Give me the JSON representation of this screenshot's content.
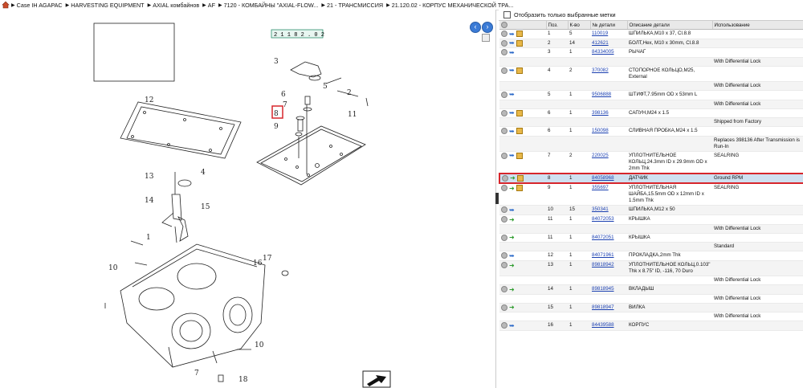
{
  "breadcrumb": [
    "Case IH AGAPAC",
    "HARVESTING EQUIPMENT",
    "AXIAL комбайнов",
    "AF",
    "7120 - КОМБАЙНЫ \"AXIAL-FLOW...",
    "21 - ТРАНСМИССИЯ",
    "21.120.02 - КОРПУС МЕХАНИЧЕСКОЙ ТРА..."
  ],
  "filter_label": "Отобразить только выбранные метки",
  "columns": [
    "",
    "Поз.",
    "К-во",
    "№ детали",
    "Описание детали",
    "Использование"
  ],
  "diagram": {
    "code": "2 1 1 8 2 . 0 2",
    "callouts": [
      "3",
      "5",
      "12",
      "6",
      "7",
      "8",
      "9",
      "2",
      "11",
      "13",
      "4",
      "14",
      "15",
      "1",
      "10",
      "16",
      "17",
      "10",
      "7",
      "18"
    ]
  },
  "rows": [
    {
      "icons": "cb",
      "pos": "1",
      "qty": "5",
      "pn": "110019",
      "desc": "ШПИЛЬКА,M10 x 37, Cl.8.8",
      "use": ""
    },
    {
      "icons": "cb",
      "pos": "2",
      "qty": "14",
      "pn": "412621",
      "desc": "БОЛТ,Hex, M10 x 30mm, Cl.8.8",
      "use": ""
    },
    {
      "icons": "c",
      "pos": "3",
      "qty": "1",
      "pn": "84334005",
      "desc": "РЫЧАГ",
      "use": ""
    },
    {
      "icons": "",
      "pos": "",
      "qty": "",
      "pn": "",
      "desc": "",
      "use": "With Differential Lock"
    },
    {
      "icons": "cb",
      "pos": "4",
      "qty": "2",
      "pn": "370082",
      "desc": "СТОПОРНОЕ КОЛЬЦО,M25, External",
      "use": ""
    },
    {
      "icons": "",
      "pos": "",
      "qty": "",
      "pn": "",
      "desc": "",
      "use": "With Differential Lock"
    },
    {
      "icons": "c",
      "pos": "5",
      "qty": "1",
      "pn": "9506888",
      "desc": "ШТИФТ,7.95mm OD x 53mm L",
      "use": ""
    },
    {
      "icons": "",
      "pos": "",
      "qty": "",
      "pn": "",
      "desc": "",
      "use": "With Differential Lock"
    },
    {
      "icons": "cb",
      "pos": "6",
      "qty": "1",
      "pn": "398136",
      "desc": "САПУН,M24 x 1.5",
      "use": ""
    },
    {
      "icons": "",
      "pos": "",
      "qty": "",
      "pn": "",
      "desc": "",
      "use": "Shipped from Factory"
    },
    {
      "icons": "cb",
      "pos": "6",
      "qty": "1",
      "pn": "150098",
      "desc": "СЛИВНАЯ ПРОБКА,M24 x 1.5",
      "use": ""
    },
    {
      "icons": "",
      "pos": "",
      "qty": "",
      "pn": "",
      "desc": "",
      "use": "Replaces 398136 After Transmission is Run-In"
    },
    {
      "icons": "cb",
      "pos": "7",
      "qty": "2",
      "pn": "220025",
      "desc": "УПЛОТНИТЕЛЬНОЕ КОЛЬЦ,24.3mm ID x 29.9mm OD x 2mm Thk",
      "use": "SEALRING"
    },
    {
      "icons": "gb",
      "pos": "8",
      "qty": "1",
      "pn": "84058968",
      "desc": "ДАТЧИК",
      "use": "Ground RPM",
      "sel": true
    },
    {
      "icons": "gb",
      "pos": "9",
      "qty": "1",
      "pn": "355697",
      "desc": "УПЛОТНИТЕЛЬНАЯ ШАЙБА,15.5mm OD x 12mm ID x 1.5mm Thk",
      "use": "SEALRING"
    },
    {
      "icons": "c",
      "pos": "10",
      "qty": "15",
      "pn": "350341",
      "desc": "ШПИЛЬКА,M12 x 50",
      "use": ""
    },
    {
      "icons": "g",
      "pos": "11",
      "qty": "1",
      "pn": "84072053",
      "desc": "КРЫШКА",
      "use": ""
    },
    {
      "icons": "",
      "pos": "",
      "qty": "",
      "pn": "",
      "desc": "",
      "use": "With Differential Lock"
    },
    {
      "icons": "g",
      "pos": "11",
      "qty": "1",
      "pn": "84072051",
      "desc": "КРЫШКА",
      "use": ""
    },
    {
      "icons": "",
      "pos": "",
      "qty": "",
      "pn": "",
      "desc": "",
      "use": "Standard"
    },
    {
      "icons": "c",
      "pos": "12",
      "qty": "1",
      "pn": "84071961",
      "desc": "ПРОКЛАДКА,2mm Thk",
      "use": ""
    },
    {
      "icons": "g",
      "pos": "13",
      "qty": "1",
      "pn": "89818942",
      "desc": "УПЛОТНИТЕЛЬНОЕ КОЛЬЦ,0.103\" Thk x 8.75\" ID, -116, 70 Duro",
      "use": ""
    },
    {
      "icons": "",
      "pos": "",
      "qty": "",
      "pn": "",
      "desc": "",
      "use": "With Differential Lock"
    },
    {
      "icons": "g",
      "pos": "14",
      "qty": "1",
      "pn": "89818945",
      "desc": "ВКЛАДЫШ",
      "use": ""
    },
    {
      "icons": "",
      "pos": "",
      "qty": "",
      "pn": "",
      "desc": "",
      "use": "With Differential Lock"
    },
    {
      "icons": "g",
      "pos": "15",
      "qty": "1",
      "pn": "89818947",
      "desc": "ВИЛКА",
      "use": ""
    },
    {
      "icons": "",
      "pos": "",
      "qty": "",
      "pn": "",
      "desc": "",
      "use": "With Differential Lock"
    },
    {
      "icons": "c",
      "pos": "16",
      "qty": "1",
      "pn": "84439588",
      "desc": "КОРПУС",
      "use": ""
    }
  ]
}
